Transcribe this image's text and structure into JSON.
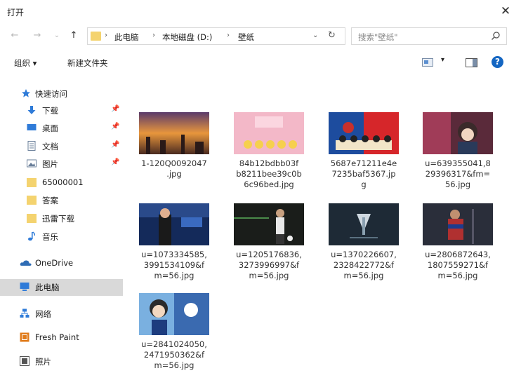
{
  "window": {
    "title": "打开",
    "close_glyph": "✕"
  },
  "nav_buttons": {
    "back": "←",
    "forward": "→",
    "recent": "⌄",
    "up": "↑"
  },
  "address": {
    "crumbs": [
      "此电脑",
      "本地磁盘 (D:)",
      "壁纸"
    ],
    "separator": "›",
    "dropdown_glyph": "⌄",
    "refresh_glyph": "↻"
  },
  "search": {
    "placeholder": "搜索\"壁纸\""
  },
  "toolbar": {
    "organize": "组织 ▾",
    "new_folder": "新建文件夹",
    "view_dropdown": "▾",
    "help": "?"
  },
  "sidebar": {
    "items": [
      {
        "label": "快速访问",
        "icon": "star-icon",
        "color": "#2f7bd8"
      },
      {
        "label": "下载",
        "icon": "download-icon",
        "color": "#2f7bd8",
        "pinned": true
      },
      {
        "label": "桌面",
        "icon": "desktop-icon",
        "color": "#2f7bd8",
        "pinned": true
      },
      {
        "label": "文档",
        "icon": "document-icon",
        "color": "#6a7f9a",
        "pinned": true
      },
      {
        "label": "图片",
        "icon": "pictures-icon",
        "color": "#6a7f9a",
        "pinned": true
      },
      {
        "label": "65000001",
        "icon": "folder-icon",
        "color": "#f4d36f"
      },
      {
        "label": "答案",
        "icon": "folder-icon",
        "color": "#f4d36f"
      },
      {
        "label": "迅雷下载",
        "icon": "folder-icon",
        "color": "#f4d36f"
      },
      {
        "label": "音乐",
        "icon": "music-icon",
        "color": "#2f7bd8"
      },
      {
        "label": "OneDrive",
        "icon": "cloud-icon",
        "color": "#2f6db5"
      },
      {
        "label": "此电脑",
        "icon": "computer-icon",
        "color": "#2f7bd8",
        "selected": true
      },
      {
        "label": "网络",
        "icon": "network-icon",
        "color": "#2f7bd8"
      },
      {
        "label": "Fresh Paint",
        "icon": "fresh-paint-icon",
        "color": "#e07b1a"
      },
      {
        "label": "照片",
        "icon": "photos-icon",
        "color": "#555555"
      }
    ],
    "pin_glyph": "📌"
  },
  "files": [
    {
      "name": "1-120Q0092047.jpg",
      "lines": [
        "1-120Q0092047",
        ".jpg"
      ]
    },
    {
      "name": "84b12bdbb03fb8211bee39c0b6c96bed.jpg",
      "lines": [
        "84b12bdbb03f",
        "b8211bee39c0b",
        "6c96bed.jpg"
      ]
    },
    {
      "name": "5687e71211e4e7235baf5367.jpg",
      "lines": [
        "5687e71211e4e",
        "7235baf5367.jp",
        "g"
      ]
    },
    {
      "name": "u=639355041,829396317&fm=56.jpg",
      "lines": [
        "u=639355041,8",
        "29396317&fm=",
        "56.jpg"
      ]
    },
    {
      "name": "u=1073334585,3991534109&fm=56.jpg",
      "lines": [
        "u=1073334585,",
        "3991534109&f",
        "m=56.jpg"
      ]
    },
    {
      "name": "u=1205176836,3273996997&fm=56.jpg",
      "lines": [
        "u=1205176836,",
        "3273996997&f",
        "m=56.jpg"
      ]
    },
    {
      "name": "u=1370226607,2328422772&fm=56.jpg",
      "lines": [
        "u=1370226607,",
        "2328422772&f",
        "m=56.jpg"
      ]
    },
    {
      "name": "u=2806872643,1807559271&fm=56.jpg",
      "lines": [
        "u=2806872643,",
        "1807559271&f",
        "m=56.jpg"
      ]
    },
    {
      "name": "u=2841024050,2471950362&fm=56.jpg",
      "lines": [
        "u=2841024050,",
        "2471950362&f",
        "m=56.jpg"
      ]
    }
  ]
}
